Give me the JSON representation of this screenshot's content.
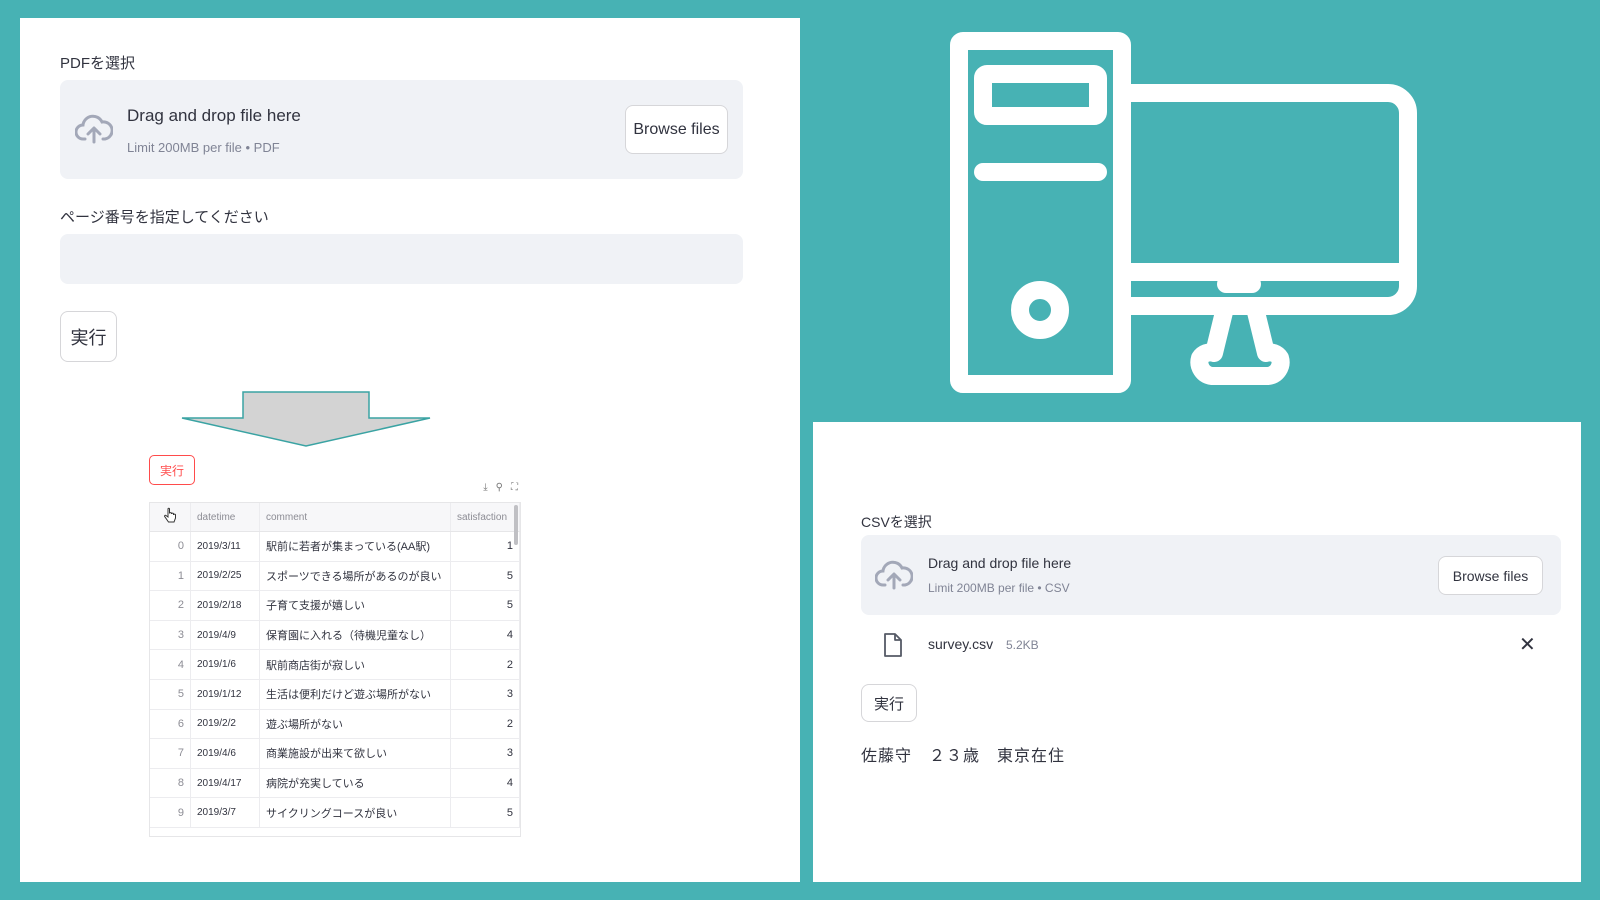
{
  "left": {
    "pdf_label": "PDFを選択",
    "pdf_upload": {
      "title": "Drag and drop file here",
      "limit": "Limit 200MB per file • PDF",
      "browse_label": "Browse files"
    },
    "page_label": "ページ番号を指定してください",
    "page_input_value": "",
    "run_label": "実行"
  },
  "mini": {
    "run_label": "実行",
    "toolbar": [
      "download-icon",
      "search-icon",
      "fullscreen-icon"
    ],
    "columns": [
      "datetime",
      "comment",
      "satisfaction"
    ],
    "rows": [
      {
        "index": "0",
        "datetime": "2019/3/11",
        "comment": "駅前に若者が集まっている(AA駅)",
        "satisfaction": "1"
      },
      {
        "index": "1",
        "datetime": "2019/2/25",
        "comment": "スポーツできる場所があるのが良い",
        "satisfaction": "5"
      },
      {
        "index": "2",
        "datetime": "2019/2/18",
        "comment": "子育て支援が嬉しい",
        "satisfaction": "5"
      },
      {
        "index": "3",
        "datetime": "2019/4/9",
        "comment": "保育園に入れる（待機児童なし）",
        "satisfaction": "4"
      },
      {
        "index": "4",
        "datetime": "2019/1/6",
        "comment": "駅前商店街が寂しい",
        "satisfaction": "2"
      },
      {
        "index": "5",
        "datetime": "2019/1/12",
        "comment": "生活は便利だけど遊ぶ場所がない",
        "satisfaction": "3"
      },
      {
        "index": "6",
        "datetime": "2019/2/2",
        "comment": "遊ぶ場所がない",
        "satisfaction": "2"
      },
      {
        "index": "7",
        "datetime": "2019/4/6",
        "comment": "商業施設が出来て欲しい",
        "satisfaction": "3"
      },
      {
        "index": "8",
        "datetime": "2019/4/17",
        "comment": "病院が充実している",
        "satisfaction": "4"
      },
      {
        "index": "9",
        "datetime": "2019/3/7",
        "comment": "サイクリングコースが良い",
        "satisfaction": "5"
      }
    ]
  },
  "right": {
    "csv_label": "CSVを選択",
    "csv_upload": {
      "title": "Drag and drop file here",
      "limit": "Limit 200MB per file • CSV",
      "browse_label": "Browse files"
    },
    "uploaded_file": {
      "name": "survey.csv",
      "size": "5.2KB",
      "remove_icon": "close-icon"
    },
    "run_label": "実行",
    "result": "佐藤守　２３歳　東京在住"
  },
  "colors": {
    "background": "#47b2b4",
    "panel": "#ffffff",
    "dropzone": "#f0f2f6",
    "primary_red": "#ff4b4b",
    "arrow_fill": "#d3d3d3",
    "arrow_stroke": "#3aa3a3"
  },
  "illustration": {
    "icon": "desktop-computer-icon"
  }
}
